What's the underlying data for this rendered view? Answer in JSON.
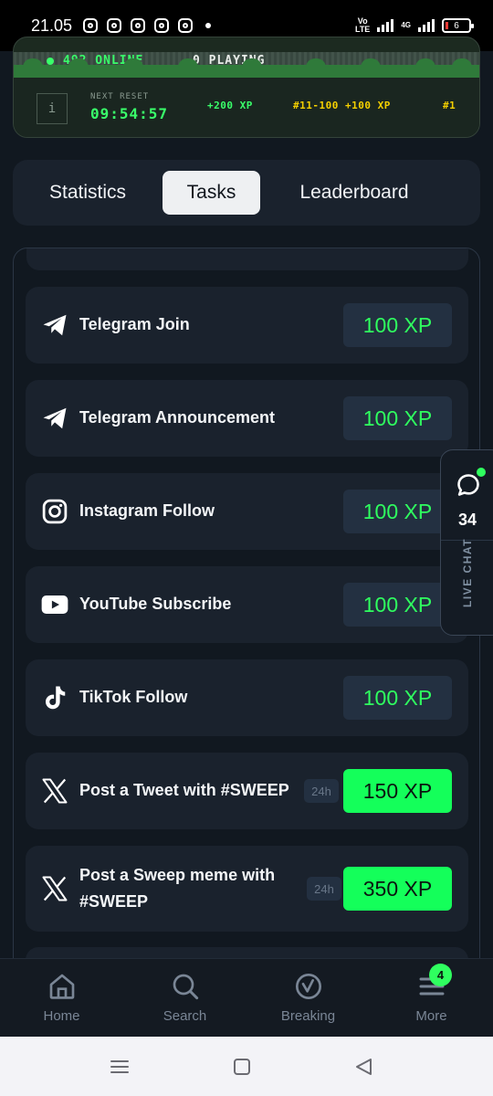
{
  "status_bar": {
    "time": "21.05",
    "volte_top": "Vo",
    "volte_bottom": "LTE",
    "network": "4G",
    "battery": "6",
    "notification_icons": [
      "instagram-icon",
      "instagram-icon",
      "instagram-icon",
      "instagram-icon",
      "instagram-icon"
    ]
  },
  "game_banner": {
    "online_text": "492 ONLINE",
    "playing_text": "0 PLAYING",
    "info_glyph": "i",
    "next_reset_label": "NEXT RESET",
    "countdown": "09:54:57",
    "reward_1": "+200 XP",
    "reward_2": "#11-100 +100 XP",
    "reward_3": "#1",
    "colors": {
      "online": "#39ff6a",
      "reward": "#f5d000",
      "reward_green": "#39ff6a"
    }
  },
  "tabs": {
    "items": [
      "Statistics",
      "Tasks",
      "Leaderboard"
    ],
    "active": "Tasks"
  },
  "tasks": [
    {
      "icon": "telegram-icon",
      "label": "Telegram Join",
      "xp": "100 XP",
      "highlight": false
    },
    {
      "icon": "telegram-icon",
      "label": "Telegram Announcement",
      "xp": "100 XP",
      "highlight": false
    },
    {
      "icon": "instagram-icon",
      "label": "Instagram Follow",
      "xp": "100 XP",
      "highlight": false
    },
    {
      "icon": "youtube-icon",
      "label": "YouTube Subscribe",
      "xp": "100 XP",
      "highlight": false
    },
    {
      "icon": "tiktok-icon",
      "label": "TikTok Follow",
      "xp": "100 XP",
      "highlight": false
    },
    {
      "icon": "x-logo-icon",
      "label": "Post a Tweet with #SWEEP",
      "badge": "24h",
      "xp": "150 XP",
      "highlight": true
    },
    {
      "icon": "x-logo-icon",
      "label_line1": "Post a Sweep meme with",
      "label_line2": "#SWEEP",
      "badge": "24h",
      "xp": "350 XP",
      "highlight": true
    }
  ],
  "live_chat": {
    "count": "34",
    "label": "LIVE CHAT"
  },
  "bottom_nav": {
    "items": [
      {
        "icon": "home-icon",
        "label": "Home"
      },
      {
        "icon": "search-icon",
        "label": "Search"
      },
      {
        "icon": "breaking-icon",
        "label": "Breaking"
      },
      {
        "icon": "menu-icon",
        "label": "More"
      }
    ],
    "more_badge": "4"
  },
  "system_nav": [
    "recents-icon",
    "home-square-icon",
    "back-triangle-icon"
  ],
  "colors": {
    "background": "#111820",
    "card": "#1a222d",
    "accent_green": "#2fff5f",
    "xp_box": "#233041"
  }
}
